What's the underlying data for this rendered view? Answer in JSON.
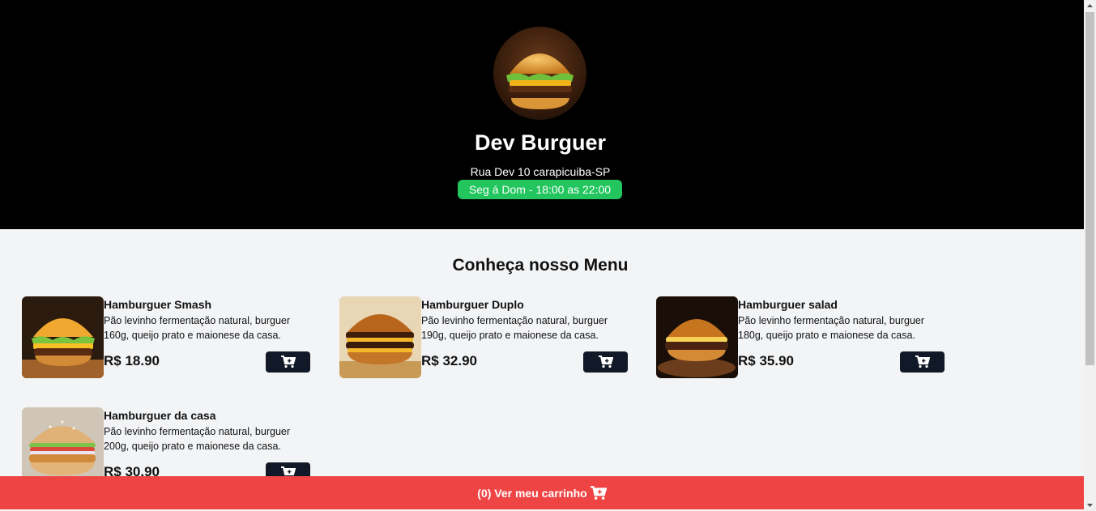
{
  "header": {
    "logo_icon": "burger-image",
    "store_name": "Dev Burguer",
    "address": "Rua Dev 10 carapicuiba-SP",
    "hours": "Seg á Dom - 18:00 as 22:00",
    "hours_color": "#22c55e"
  },
  "menu": {
    "title": "Conheça nosso Menu",
    "items": [
      {
        "name": "Hamburguer Smash",
        "description": "Pão levinho fermentação natural, burguer 160g, queijo prato e maionese da casa.",
        "price": "R$ 18.90",
        "image": "burger-smash-image",
        "button_icon": "cart-plus-icon"
      },
      {
        "name": "Hamburguer Duplo",
        "description": "Pão levinho fermentação natural, burguer 190g, queijo prato e maionese da casa.",
        "price": "R$ 32.90",
        "image": "burger-duplo-image",
        "button_icon": "cart-plus-icon"
      },
      {
        "name": "Hamburguer salad",
        "description": "Pão levinho fermentação natural, burguer 180g, queijo prato e maionese da casa.",
        "price": "R$ 35.90",
        "image": "burger-salad-image",
        "button_icon": "cart-plus-icon"
      },
      {
        "name": "Hamburguer da casa",
        "description": "Pão levinho fermentação natural, burguer 200g, queijo prato e maionese da casa.",
        "price": "R$ 30.90",
        "image": "burger-casa-image",
        "button_icon": "cart-plus-icon"
      }
    ]
  },
  "cart": {
    "label": "(0) Ver meu carrinho",
    "icon": "cart-plus-icon",
    "color": "#ef4444"
  },
  "colors": {
    "hero_background": "#000000",
    "page_background": "#f3f4f6",
    "button_background": "#111827"
  }
}
